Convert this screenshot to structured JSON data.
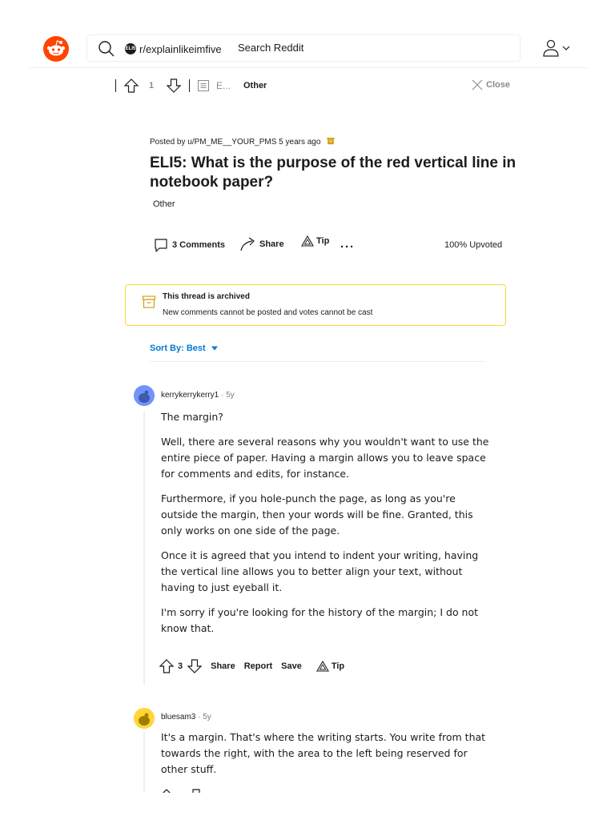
{
  "header": {
    "community_chip": "r/explainlikeimfive",
    "community_icon_text": "ELI5",
    "search_placeholder": "Search Reddit"
  },
  "post_bar": {
    "vote_count": "1",
    "breadcrumb": "E...",
    "flair": "Other",
    "close_label": "Close"
  },
  "post": {
    "meta": "Posted by u/PM_ME__YOUR_PMS 5 years ago",
    "title": "ELI5: What is the purpose of the red vertical line in notebook paper?",
    "flair": "Other",
    "actions": {
      "comments": "3 Comments",
      "share": "Share",
      "tip": "Tip"
    },
    "upvoted": "100% Upvoted"
  },
  "archived": {
    "title": "This thread is archived",
    "subtitle": "New comments cannot be posted and votes cannot be cast"
  },
  "sort": {
    "label": "Sort By: Best"
  },
  "comments": [
    {
      "author": "kerrykerrykerry1",
      "time": "5y",
      "paragraphs": [
        "The margin?",
        "Well, there are several reasons why you wouldn't want to use the entire piece of paper. Having a margin allows you to leave space for comments and edits, for instance.",
        "Furthermore, if you hole-punch the page, as long as you're outside the margin, then your words will be fine. Granted, this only works on one side of the page.",
        "Once it is agreed that you intend to indent your writing, having the vertical line allows you to better align your text, without having to just eyeball it.",
        "I'm sorry if you're looking for the history of the margin; I do not know that."
      ],
      "score": "3",
      "actions": {
        "share": "Share",
        "report": "Report",
        "save": "Save",
        "tip": "Tip"
      }
    },
    {
      "author": "bluesam3",
      "time": "5y",
      "paragraphs": [
        "It's a margin. That's where the writing starts. You write from that towards the right, with the area to the left being reserved for other stuff."
      ]
    }
  ],
  "colors": {
    "brand": "#ff4500",
    "link_blue": "#0079d3",
    "archive_border": "#ffd635",
    "archive_icon": "#d4a017"
  }
}
